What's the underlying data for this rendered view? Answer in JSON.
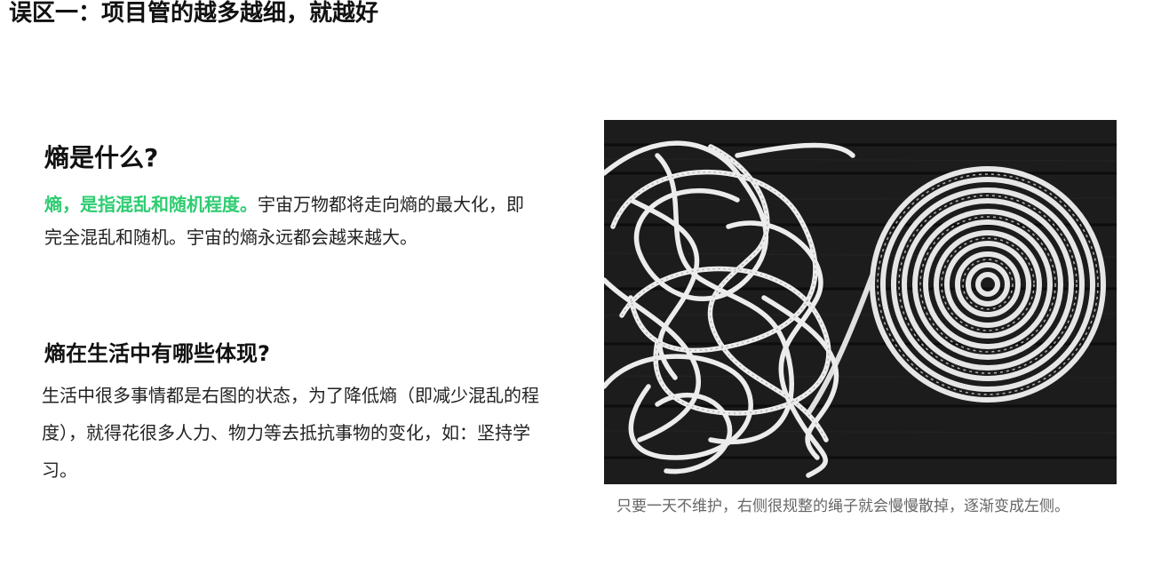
{
  "slide": {
    "title": "误区一：项目管的越多越细，就越好"
  },
  "section1": {
    "heading": "熵是什么?",
    "highlight": "熵，是指混乱和随机程度。",
    "text": "宇宙万物都将走向熵的最大化，即完全混乱和随机。宇宙的熵永远都会越来越大。",
    "highlight_color": "#2ecc71"
  },
  "section2": {
    "heading": "熵在生活中有哪些体现?",
    "text": "生活中很多事情都是右图的状态，为了降低熵（即减少混乱的程度），就得花很多人力、物力等去抵抗事物的变化，如：坚持学习。"
  },
  "photo": {
    "caption": "只要一天不维护，右侧很规整的绳子就会慢慢散掉，逐渐变成左侧。"
  }
}
